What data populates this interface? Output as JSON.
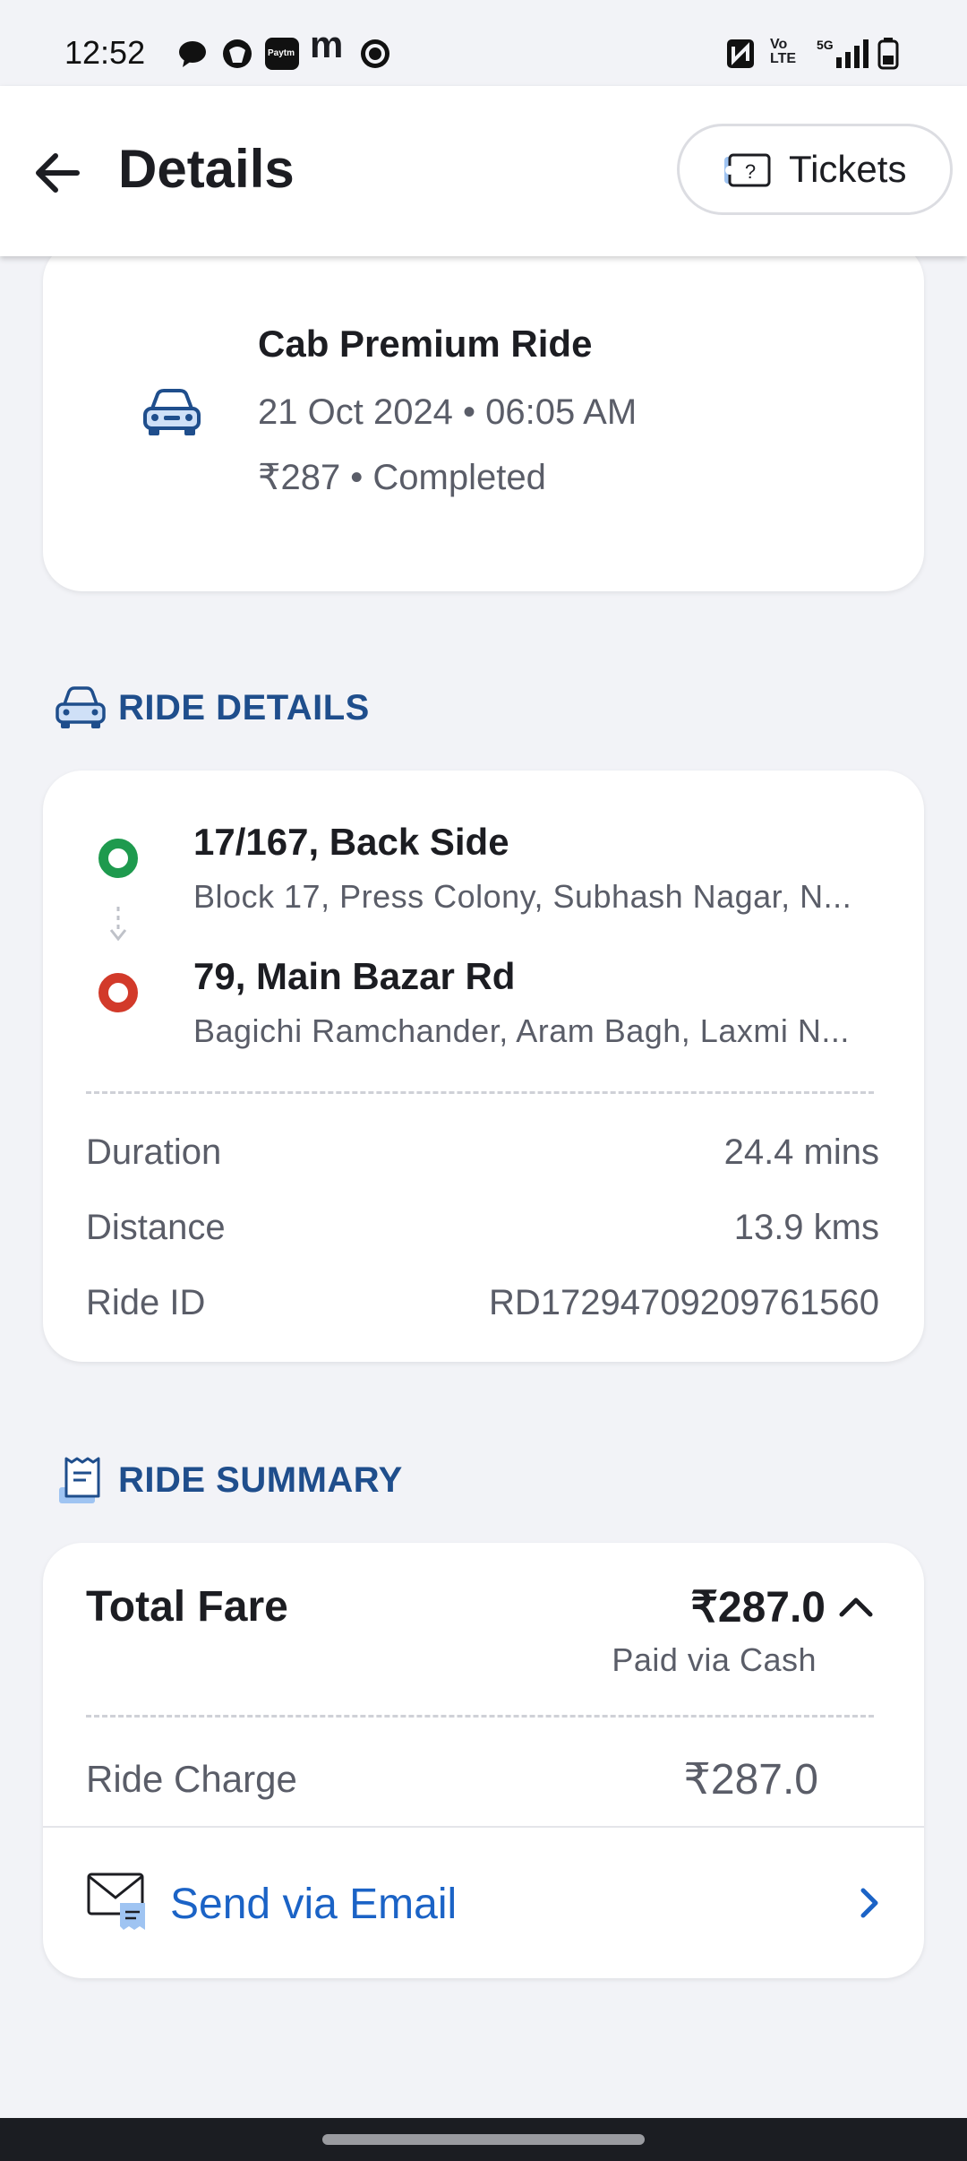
{
  "status_bar": {
    "time": "12:52",
    "left_icons": [
      "chat-bubble-icon",
      "app-icon",
      "paytm-icon",
      "m-icon",
      "circle-app-icon"
    ],
    "paytm_text": "Paytm",
    "m_text": "m",
    "right_icons": [
      "nfc-icon",
      "volte-icon",
      "signal-5g-icon",
      "battery-icon"
    ],
    "volte_text": "Vo LTE",
    "network_text": "5G"
  },
  "header": {
    "title": "Details",
    "tickets_label": "Tickets"
  },
  "ride": {
    "title": "Cab Premium Ride",
    "datetime": "21 Oct 2024 • 06:05 AM",
    "price_status": "₹287 • Completed"
  },
  "ride_details": {
    "heading": "RIDE DETAILS",
    "pickup": {
      "title": "17/167, Back Side",
      "subtitle": "Block 17, Press Colony, Subhash Nagar, N..."
    },
    "drop": {
      "title": "79, Main Bazar Rd",
      "subtitle": "Bagichi Ramchander, Aram Bagh, Laxmi N..."
    },
    "info": [
      {
        "label": "Duration",
        "value": "24.4 mins"
      },
      {
        "label": "Distance",
        "value": "13.9 kms"
      },
      {
        "label": "Ride ID",
        "value": "RD17294709209761560"
      }
    ]
  },
  "ride_summary": {
    "heading": "RIDE SUMMARY",
    "total_label": "Total Fare",
    "total_value": "₹287.0",
    "paid_via": "Paid via Cash",
    "charge_label": "Ride Charge",
    "charge_value": "₹287.0",
    "email_label": "Send via Email"
  },
  "colors": {
    "background": "#f2f3f7",
    "accent_blue": "#1b63c6",
    "section_heading": "#1f4e8c",
    "pickup_green": "#1e9a4e",
    "drop_red": "#d23a2a"
  }
}
